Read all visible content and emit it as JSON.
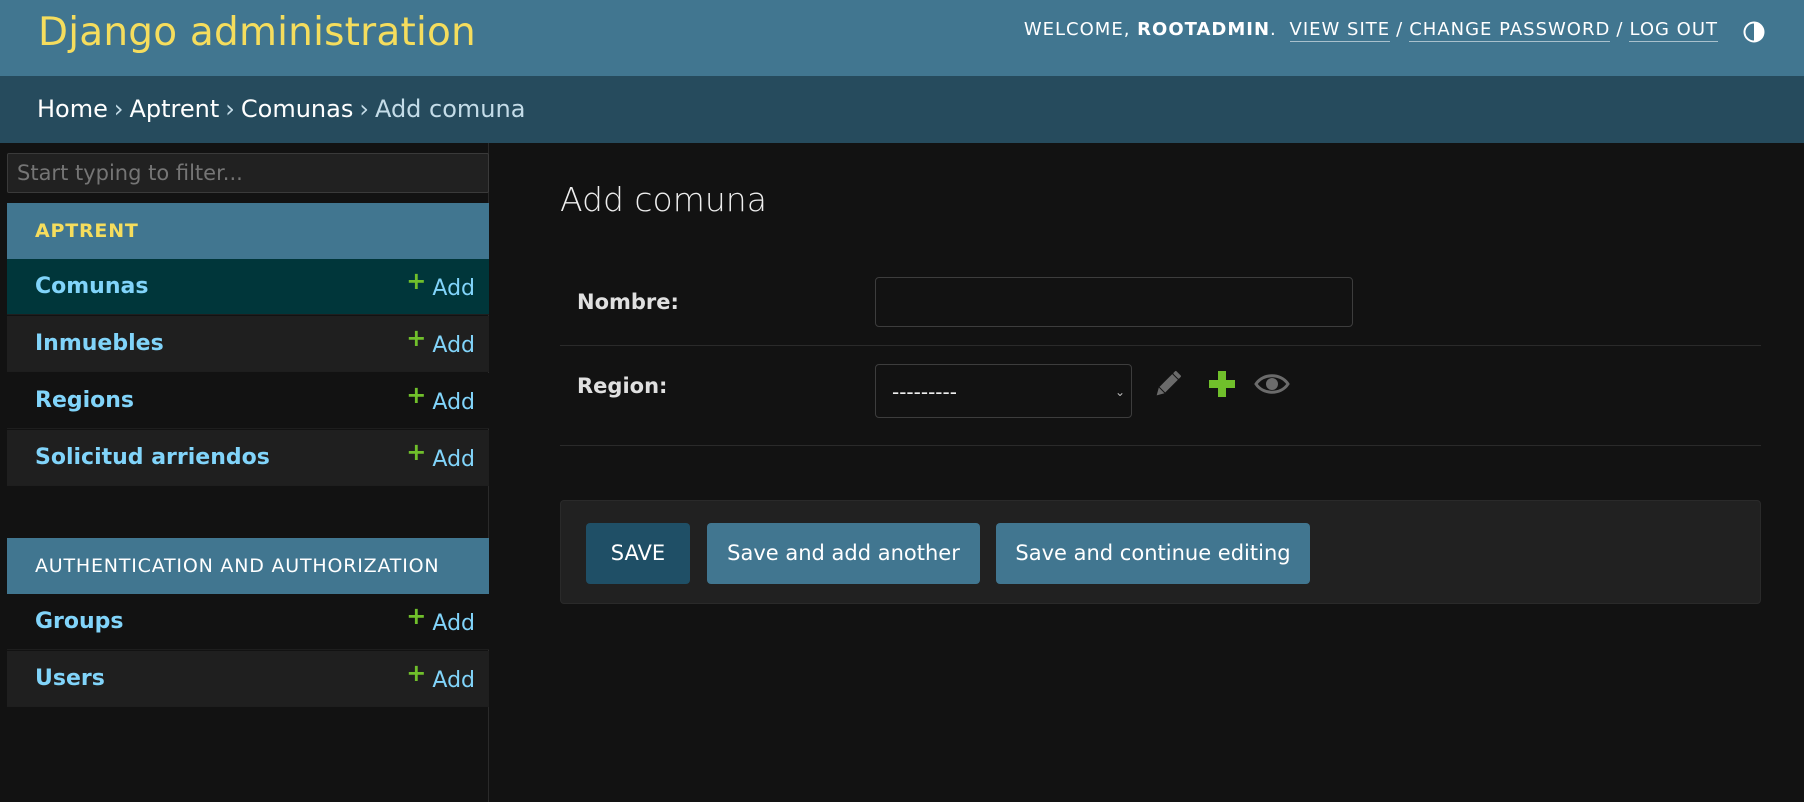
{
  "header": {
    "brand": "Django administration",
    "welcome_prefix": "WELCOME, ",
    "username": "ROOTADMIN",
    "username_suffix": ".",
    "view_site": "VIEW SITE",
    "change_password": "CHANGE PASSWORD",
    "log_out": "LOG OUT",
    "separator": "/"
  },
  "breadcrumbs": {
    "home": "Home",
    "app": "Aptrent",
    "model": "Comunas",
    "current": "Add comuna",
    "arrow": "›"
  },
  "sidebar": {
    "filter_placeholder": "Start typing to filter...",
    "modules": [
      {
        "caption": "APTRENT",
        "items": [
          {
            "name": "Comunas",
            "add": "Add"
          },
          {
            "name": "Inmuebles",
            "add": "Add"
          },
          {
            "name": "Regions",
            "add": "Add"
          },
          {
            "name": "Solicitud arriendos",
            "add": "Add"
          }
        ]
      },
      {
        "caption": "AUTHENTICATION AND AUTHORIZATION",
        "items": [
          {
            "name": "Groups",
            "add": "Add"
          },
          {
            "name": "Users",
            "add": "Add"
          }
        ]
      }
    ],
    "add_icon": "plus-icon"
  },
  "main": {
    "title": "Add comuna",
    "fields": {
      "nombre_label": "Nombre:",
      "nombre_value": "",
      "region_label": "Region:",
      "region_selected": "---------"
    },
    "buttons": {
      "save": "SAVE",
      "save_add_another": "Save and add another",
      "save_continue": "Save and continue editing"
    }
  },
  "colors": {
    "header_bg": "#417690",
    "brand": "#f5dd5d",
    "breadcrumb_bg": "#264b5d",
    "link": "#81d4fa",
    "add_green": "#70bf2b",
    "selected_row": "#00363a",
    "page_bg": "#121212"
  }
}
